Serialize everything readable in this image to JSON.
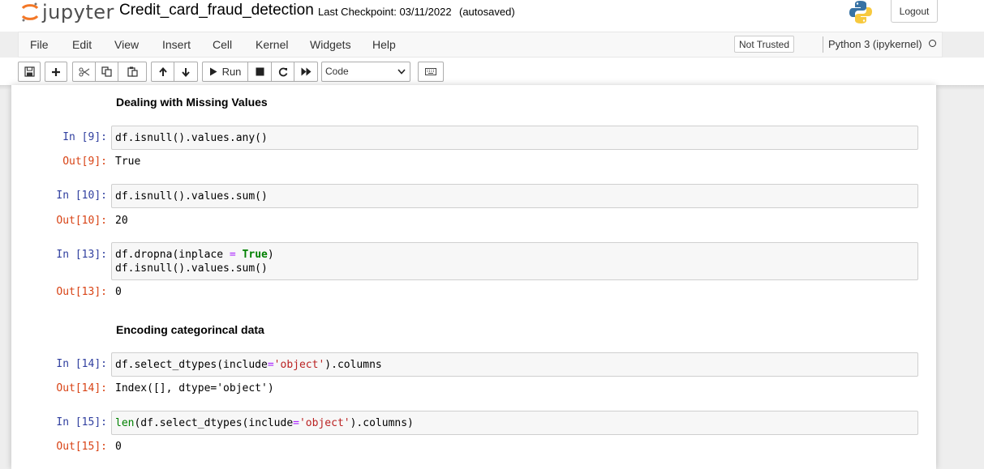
{
  "header": {
    "logo_text": "jupyter",
    "notebook_title": "Credit_card_fraud_detection",
    "checkpoint": "Last Checkpoint: 03/11/2022",
    "autosave": "(autosaved)",
    "logout_label": "Logout"
  },
  "menu": {
    "items": [
      "File",
      "Edit",
      "View",
      "Insert",
      "Cell",
      "Kernel",
      "Widgets",
      "Help"
    ],
    "trust_status": "Not Trusted",
    "kernel_name": "Python 3 (ipykernel)"
  },
  "toolbar": {
    "run_label": "Run",
    "cell_type": "Code",
    "icons": [
      "save-icon",
      "plus-icon",
      "scissors-icon",
      "copy-icon",
      "paste-icon",
      "arrow-up-icon",
      "arrow-down-icon",
      "play-icon",
      "stop-icon",
      "restart-icon",
      "fast-forward-icon",
      "keyboard-icon"
    ]
  },
  "cells": {
    "heading1": "Dealing with Missing Values",
    "c9": {
      "in_prompt": "In [9]:",
      "code": "df.isnull().values.any()",
      "out_prompt": "Out[9]:",
      "output": "True"
    },
    "c10": {
      "in_prompt": "In [10]:",
      "code": "df.isnull().values.sum()",
      "out_prompt": "Out[10]:",
      "output": "20"
    },
    "c13": {
      "in_prompt": "In [13]:",
      "line1_a": "df.dropna(inplace ",
      "line1_op": "=",
      "line1_sp": " ",
      "line1_kw": "True",
      "line1_b": ")",
      "line2": "df.isnull().values.sum()",
      "out_prompt": "Out[13]:",
      "output": "0"
    },
    "heading2": "Encoding categorincal data",
    "c14": {
      "in_prompt": "In [14]:",
      "code_a": "df.select_dtypes(include",
      "code_op": "=",
      "code_str": "'object'",
      "code_b": ").columns",
      "out_prompt": "Out[14]:",
      "output": "Index([], dtype='object')"
    },
    "c15": {
      "in_prompt": "In [15]:",
      "code_fn": "len",
      "code_a": "(df.select_dtypes(include",
      "code_op": "=",
      "code_str": "'object'",
      "code_b": ").columns)",
      "out_prompt": "Out[15]:",
      "output": "0"
    }
  },
  "colors": {
    "in_prompt": "#303f9f",
    "out_prompt": "#d84315",
    "keyword": "#008000",
    "string": "#ba2121",
    "operator": "#aa22ff"
  }
}
